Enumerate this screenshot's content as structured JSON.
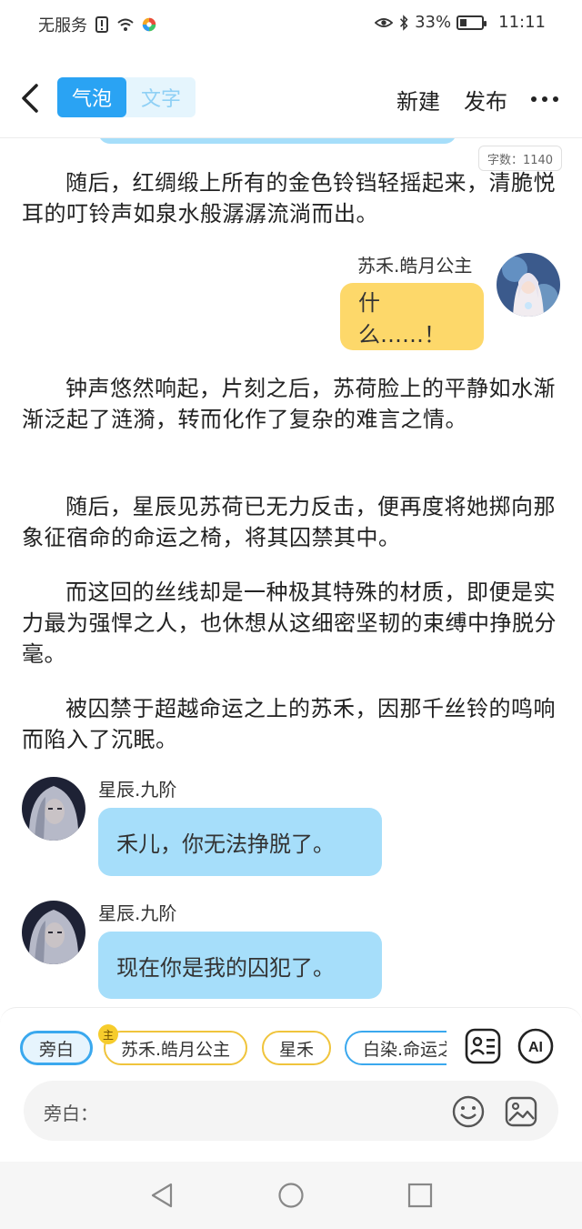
{
  "status_bar": {
    "carrier": "无服务",
    "battery_percent": "33%",
    "battery_level": 0.33,
    "time": "11:11"
  },
  "header": {
    "tab_bubble": "气泡",
    "tab_text": "文字",
    "new_label": "新建",
    "publish_label": "发布"
  },
  "content": {
    "word_count": "字数：1140",
    "paragraphs": [
      "随后，红绸缎上所有的金色铃铛轻摇起来，清脆悦耳的叮铃声如泉水般潺潺流淌而出。",
      "钟声悠然响起，片刻之后，苏荷脸上的平静如水渐渐泛起了涟漪，转而化作了复杂的难言之情。",
      "随后，星辰见苏荷已无力反击，便再度将她掷向那象征宿命的命运之椅，将其囚禁其中。",
      "而这回的丝线却是一种极其特殊的材质，即便是实力最为强悍之人，也休想从这细密坚韧的束缚中挣脱分毫。",
      "被囚禁于超越命运之上的苏禾，因那千丝铃的鸣响而陷入了沉眠。"
    ],
    "messages": [
      {
        "speaker": "苏禾.皓月公主",
        "text": "什么……！",
        "side": "right"
      },
      {
        "speaker": "星辰.九阶",
        "text": "禾儿，你无法挣脱了。",
        "side": "left"
      },
      {
        "speaker": "星辰.九阶",
        "text": "现在你是我的囚犯了。",
        "side": "left"
      }
    ]
  },
  "roles": {
    "chips": [
      "旁白",
      "苏禾.皓月公主",
      "星禾",
      "白染.命运之"
    ],
    "main_badge": "主"
  },
  "composer": {
    "label": "旁白："
  }
}
